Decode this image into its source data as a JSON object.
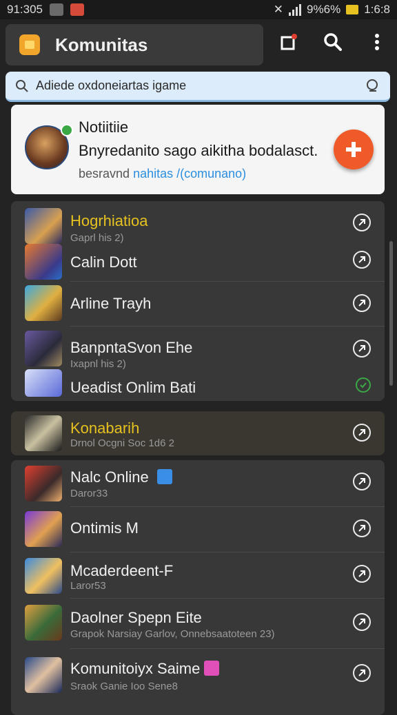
{
  "status_bar": {
    "time_left": "91:305",
    "battery_pct": "9%6%",
    "time_right": "1:6:8"
  },
  "app_bar": {
    "title": "Komunitas"
  },
  "search": {
    "placeholder": "Adiede oxdoneiartas igame"
  },
  "notification": {
    "title": "Notiitiie",
    "body": "Bnyredanito sago aikitha bodalasct.",
    "link_prefix": "besravnd",
    "link_text": "nahitas /(comunano)"
  },
  "group1": [
    {
      "name": "Hogrhiatioa",
      "sub": "Gaprl his 2)",
      "highlight": true,
      "go": "normal"
    },
    {
      "name": "Calin Dott",
      "sub": "",
      "highlight": false,
      "go": "normal"
    },
    {
      "name": "Arline Trayh",
      "sub": "",
      "highlight": false,
      "go": "normal"
    },
    {
      "name": "BanpntaSvon Ehe",
      "sub": "Ixapnl his 2)",
      "highlight": false,
      "go": "normal"
    },
    {
      "name": "Ueadist Onlim Bati",
      "sub": "",
      "highlight": false,
      "go": "green"
    }
  ],
  "group2": {
    "name": "Konabarih",
    "sub": "Drnol Ocgni Soc 1d6 2"
  },
  "group3": [
    {
      "name": "Nalc Online",
      "sub": "Daror33",
      "badge": "blue"
    },
    {
      "name": "Ontimis M",
      "sub": "",
      "badge": ""
    },
    {
      "name": "Mcaderdeent-F",
      "sub": "Laror53",
      "badge": ""
    },
    {
      "name": "Daolner Spepn Eite",
      "sub": "Grapok Narsiay Garlov, Onnebsaatoteen 23)",
      "badge": ""
    },
    {
      "name": "Komunitoiyx Saime",
      "sub": "Sraok Ganie Ioo Sene8",
      "badge": "pink"
    }
  ],
  "colors": {
    "accent": "#f05a28",
    "highlight": "#e6c220",
    "link": "#2a8ee0"
  }
}
